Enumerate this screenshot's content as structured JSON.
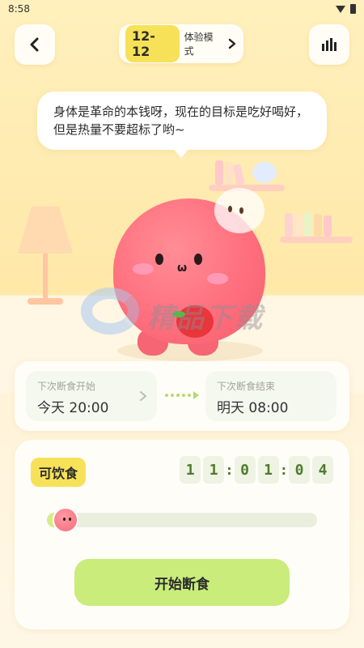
{
  "statusbar": {
    "time": "8:58"
  },
  "header": {
    "back_icon": "chevron-left-icon",
    "mode_badge": "12-12",
    "mode_label": "体验模式",
    "mode_chevron": "›",
    "stats_icon": "bar-chart-icon"
  },
  "bubble": {
    "text": "身体是革命的本钱呀，现在的目标是吃好喝好，但是热量不要超标了哟~"
  },
  "watermark": {
    "text": "精品下载"
  },
  "schedule": {
    "start_label": "下次断食开始",
    "start_value": "今天 20:00",
    "end_label": "下次断食结束",
    "end_value": "明天 08:00"
  },
  "status": {
    "state_label": "可饮食",
    "timer_digits": [
      "1",
      "1",
      "0",
      "1",
      "0",
      "4"
    ],
    "progress_fraction": 0.04,
    "start_button": "开始断食"
  },
  "colors": {
    "accent_yellow": "#f7e158",
    "accent_green": "#c9ec7b",
    "character_pink": "#ff6f7d",
    "background": "#ffe8a8"
  }
}
